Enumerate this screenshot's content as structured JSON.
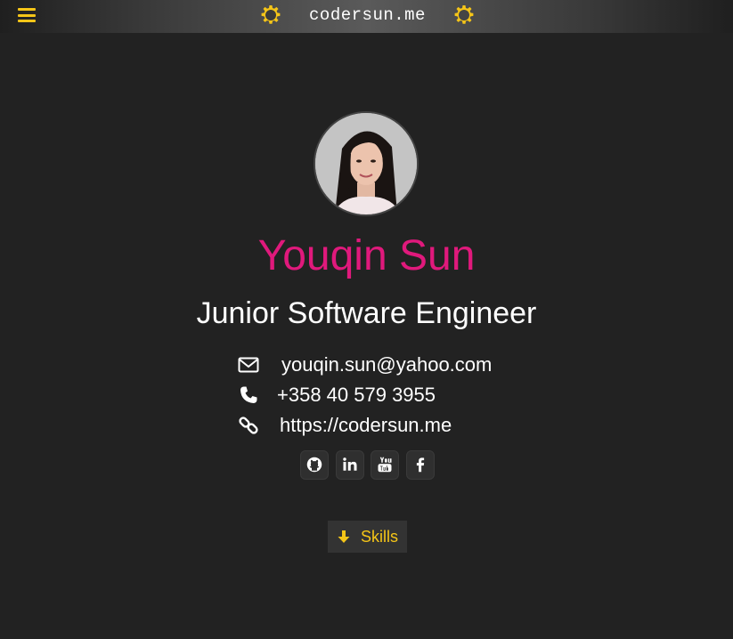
{
  "header": {
    "brand": "codersun.me"
  },
  "profile": {
    "name": "Youqin Sun",
    "title": "Junior Software Engineer"
  },
  "contact": {
    "email": "youqin.sun@yahoo.com",
    "phone": "+358 40 579 3955",
    "website": "https://codersun.me"
  },
  "social": [
    "github",
    "linkedin",
    "youtube",
    "facebook"
  ],
  "skills_button": {
    "label": "Skills"
  },
  "colors": {
    "background": "#222222",
    "accent": "#f5c518",
    "name": "#e0197c",
    "text": "#ffffff"
  }
}
